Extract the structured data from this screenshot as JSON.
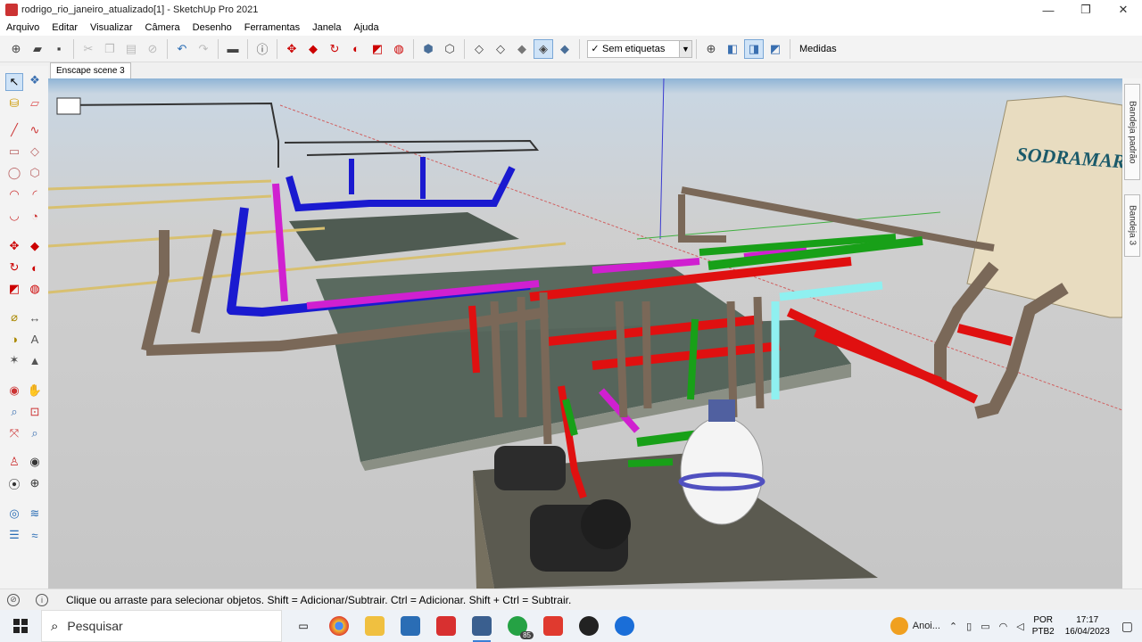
{
  "window": {
    "title": "rodrigo_rio_janeiro_atualizado[1] - SketchUp Pro 2021",
    "minimize": "—",
    "maximize": "❐",
    "close": "✕"
  },
  "menu": [
    "Arquivo",
    "Editar",
    "Visualizar",
    "Câmera",
    "Desenho",
    "Ferramentas",
    "Janela",
    "Ajuda"
  ],
  "toolbar": {
    "tag_check": "✓",
    "tag_value": "Sem etiquetas",
    "measure_label": "Medidas"
  },
  "scene_tab": "Enscape scene 3",
  "right_panels": [
    "Bandeja padrão",
    "Bandeja 3"
  ],
  "viewport": {
    "sign_text": "SODRAMAR",
    "sky_color": "#d8e2ea",
    "ground_color": "#c8c8c8"
  },
  "status": {
    "text": "Clique ou arraste para selecionar objetos. Shift = Adicionar/Subtrair. Ctrl = Adicionar. Shift + Ctrl = Subtrair."
  },
  "taskbar": {
    "search": "Pesquisar",
    "whatsapp_badge": "85",
    "weather": "Anoi...",
    "lang_top": "POR",
    "lang_bottom": "PTB2",
    "time": "17:17",
    "date": "16/04/2023"
  }
}
